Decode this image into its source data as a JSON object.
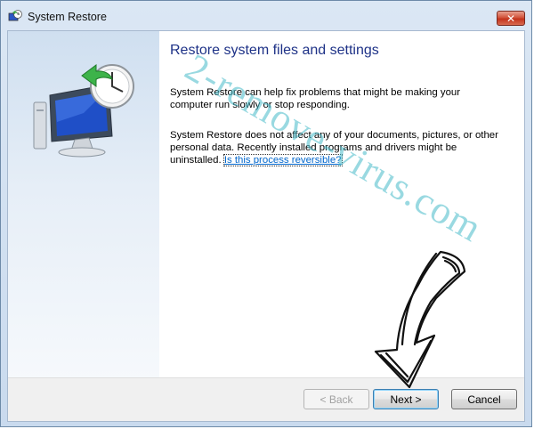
{
  "window": {
    "title": "System Restore",
    "close_label": "✕"
  },
  "main": {
    "heading": "Restore system files and settings",
    "paragraph1": "System Restore can help fix problems that might be making your computer run slowly or stop responding.",
    "paragraph2": "System Restore does not affect any of your documents, pictures, or other personal data. Recently installed programs and drivers might be uninstalled.",
    "link": "Is this process reversible?"
  },
  "footer": {
    "back_label": "< Back",
    "next_label": "Next >",
    "cancel_label": "Cancel"
  },
  "overlay": {
    "watermark_text": "2-remove-virus.com",
    "watermark_color": "#46b9c8"
  },
  "icons": [
    "system-restore-icon",
    "close-icon",
    "computer-restore-clock-icon",
    "hand-drawn-arrow"
  ]
}
